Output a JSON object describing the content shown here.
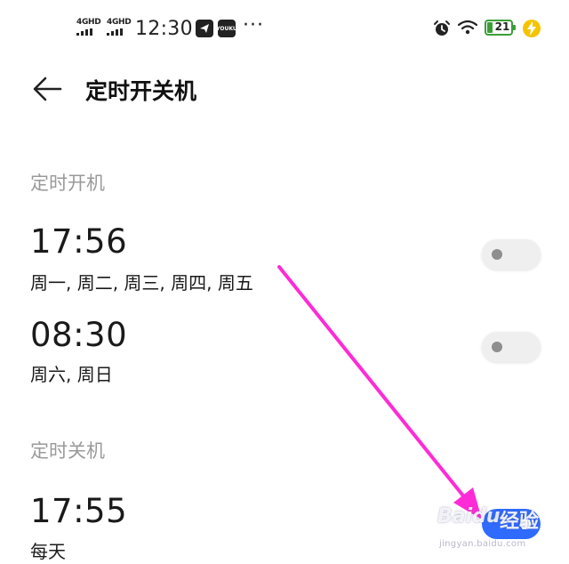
{
  "status_bar": {
    "signal1_label": "4GHD",
    "signal2_label": "4GHD",
    "time": "12:30",
    "app_icon2_label": "YOUKU",
    "more_dots": "···",
    "battery_level": "21"
  },
  "header": {
    "title": "定时开关机"
  },
  "power_on": {
    "section_title": "定时开机",
    "schedules": [
      {
        "time": "17:56",
        "days": "周一, 周二, 周三, 周四, 周五",
        "enabled": false
      },
      {
        "time": "08:30",
        "days": "周六, 周日",
        "enabled": false
      }
    ]
  },
  "power_off": {
    "section_title": "定时关机",
    "schedules": [
      {
        "time": "17:55",
        "days": "每天",
        "enabled": true
      }
    ]
  },
  "watermark": {
    "brand": "Baidu",
    "service": "经验",
    "url": "jingyan.baidu.com"
  },
  "colors": {
    "accent": "#2f6bff",
    "annotation": "#ff2bd6",
    "section_title": "#9a9a9a",
    "battery": "#3a9f3a",
    "charging": "#f5c400"
  }
}
